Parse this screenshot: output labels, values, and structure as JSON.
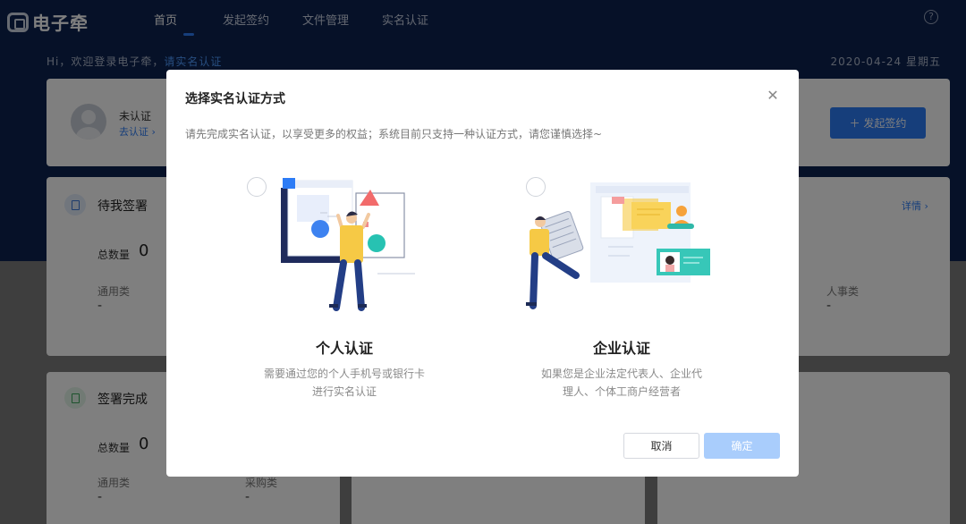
{
  "app": {
    "brand_name": "电子牵"
  },
  "nav": {
    "items": [
      {
        "label": "首页",
        "active": true
      },
      {
        "label": "发起签约",
        "active": false
      },
      {
        "label": "文件管理",
        "active": false
      },
      {
        "label": "实名认证",
        "active": false
      }
    ]
  },
  "header": {
    "welcome_prefix": "Hi，欢迎登录电子牵，",
    "welcome_link": "请实名认证",
    "date": "2020-04-24 星期五"
  },
  "profile": {
    "status": "未认证",
    "link": "去认证",
    "start_sign_button": "发起签约"
  },
  "pending": {
    "title": "待我签署",
    "total_label": "总数量",
    "total_value": "0",
    "detail_link": "详情",
    "categories": [
      {
        "label": "通用类",
        "value": "-"
      },
      {
        "label": "人事类",
        "value": "-"
      }
    ]
  },
  "completed": {
    "title": "签署完成",
    "total_label": "总数量",
    "total_value": "0",
    "categories": [
      {
        "label": "通用类",
        "value": "-"
      },
      {
        "label": "采购类",
        "value": "-"
      }
    ]
  },
  "modal": {
    "title": "选择实名认证方式",
    "description": "请先完成实名认证，以享受更多的权益；系统目前只支持一种认证方式，请您谨慎选择~",
    "options": [
      {
        "title": "个人认证",
        "desc_line1": "需要通过您的个人手机号或银行卡",
        "desc_line2": "进行实名认证"
      },
      {
        "title": "企业认证",
        "desc_line1": "如果您是企业法定代表人、企业代",
        "desc_line2": "理人、个体工商户经营者"
      }
    ],
    "cancel_label": "取消",
    "confirm_label": "确定"
  },
  "colors": {
    "header_bg": "#0d2350",
    "accent": "#2d7cf6",
    "confirm_disabled": "#a9cdfc"
  }
}
